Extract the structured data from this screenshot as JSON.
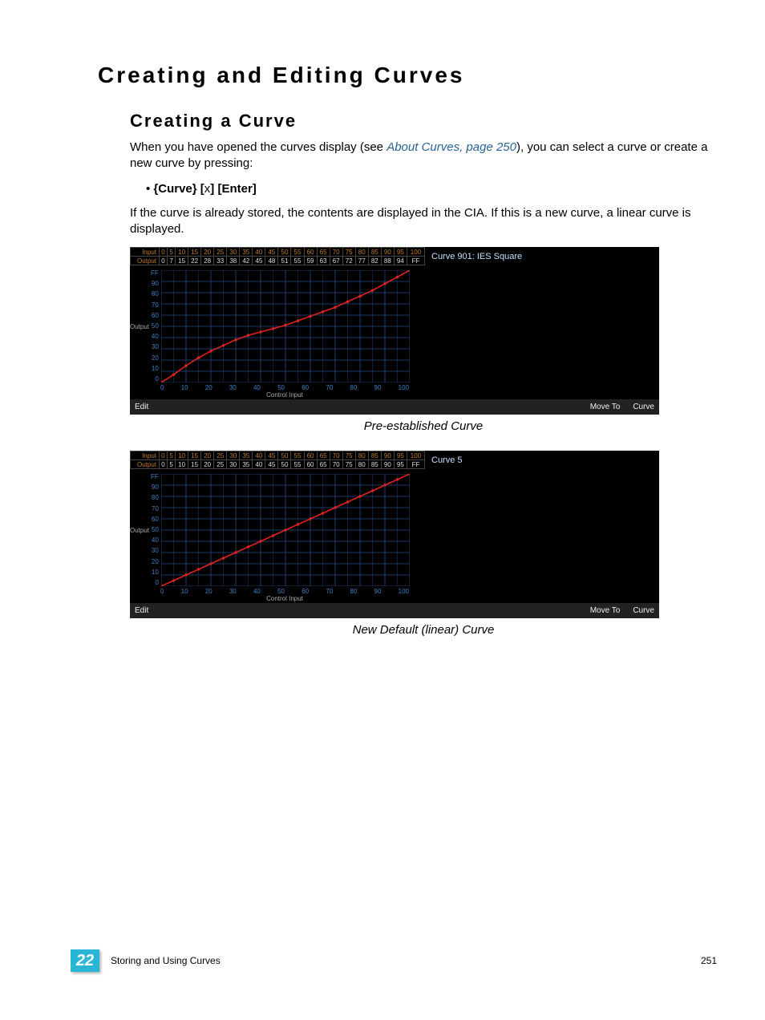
{
  "heading": "Creating and Editing Curves",
  "section_heading": "Creating a Curve",
  "intro_pre": "When you have opened the curves display (see ",
  "intro_link": "About Curves, page 250",
  "intro_post": "), you can select a curve or create a new curve by pressing:",
  "key_sequence": {
    "b1": "{Curve} [",
    "mid": "x",
    "b2": "] [Enter]"
  },
  "para2": "If the curve is already stored, the contents are displayed in the CIA. If this is a new curve, a linear curve is displayed.",
  "caption1": "Pre-established Curve",
  "caption2": "New Default (linear) Curve",
  "footer": {
    "chapter": "22",
    "title": "Storing and Using Curves",
    "page": "251"
  },
  "chart_data": [
    {
      "type": "line",
      "id": "curve1",
      "title": "Curve 901: IES Square",
      "io_header": {
        "input": [
          "0",
          "5",
          "10",
          "15",
          "20",
          "25",
          "30",
          "35",
          "40",
          "45",
          "50",
          "55",
          "60",
          "65",
          "70",
          "75",
          "80",
          "85",
          "90",
          "95",
          "100"
        ],
        "output": [
          "0",
          "7",
          "15",
          "22",
          "28",
          "33",
          "38",
          "42",
          "45",
          "48",
          "51",
          "55",
          "59",
          "63",
          "67",
          "72",
          "77",
          "82",
          "88",
          "94",
          "FF"
        ]
      },
      "xlabel": "Control Input",
      "ylabel": "Output",
      "xticks": [
        "0",
        "10",
        "20",
        "30",
        "40",
        "50",
        "60",
        "70",
        "80",
        "90",
        "100"
      ],
      "yticks": [
        "FF",
        "90",
        "80",
        "70",
        "60",
        "50",
        "40",
        "30",
        "20",
        "10",
        "0"
      ],
      "xlim": [
        0,
        100
      ],
      "ylim": [
        0,
        100
      ],
      "series": [
        {
          "name": "IES Square",
          "x": [
            0,
            5,
            10,
            15,
            20,
            25,
            30,
            35,
            40,
            45,
            50,
            55,
            60,
            65,
            70,
            75,
            80,
            85,
            90,
            95,
            100
          ],
          "values": [
            0,
            7,
            15,
            22,
            28,
            33,
            38,
            42,
            45,
            48,
            51,
            55,
            59,
            63,
            67,
            72,
            77,
            82,
            88,
            94,
            100
          ]
        }
      ],
      "statusbar": {
        "left": "Edit",
        "move": "Move To",
        "curve": "Curve"
      }
    },
    {
      "type": "line",
      "id": "curve2",
      "title": "Curve 5",
      "io_header": {
        "input": [
          "0",
          "5",
          "10",
          "15",
          "20",
          "25",
          "30",
          "35",
          "40",
          "45",
          "50",
          "55",
          "60",
          "65",
          "70",
          "75",
          "80",
          "85",
          "90",
          "95",
          "100"
        ],
        "output": [
          "0",
          "5",
          "10",
          "15",
          "20",
          "25",
          "30",
          "35",
          "40",
          "45",
          "50",
          "55",
          "60",
          "65",
          "70",
          "75",
          "80",
          "85",
          "90",
          "95",
          "FF"
        ]
      },
      "xlabel": "Control Input",
      "ylabel": "Output",
      "xticks": [
        "0",
        "10",
        "20",
        "30",
        "40",
        "50",
        "60",
        "70",
        "80",
        "90",
        "100"
      ],
      "yticks": [
        "FF",
        "90",
        "80",
        "70",
        "60",
        "50",
        "40",
        "30",
        "20",
        "10",
        "0"
      ],
      "xlim": [
        0,
        100
      ],
      "ylim": [
        0,
        100
      ],
      "series": [
        {
          "name": "Linear",
          "x": [
            0,
            5,
            10,
            15,
            20,
            25,
            30,
            35,
            40,
            45,
            50,
            55,
            60,
            65,
            70,
            75,
            80,
            85,
            90,
            95,
            100
          ],
          "values": [
            0,
            5,
            10,
            15,
            20,
            25,
            30,
            35,
            40,
            45,
            50,
            55,
            60,
            65,
            70,
            75,
            80,
            85,
            90,
            95,
            100
          ]
        }
      ],
      "statusbar": {
        "left": "Edit",
        "move": "Move To",
        "curve": "Curve"
      }
    }
  ]
}
